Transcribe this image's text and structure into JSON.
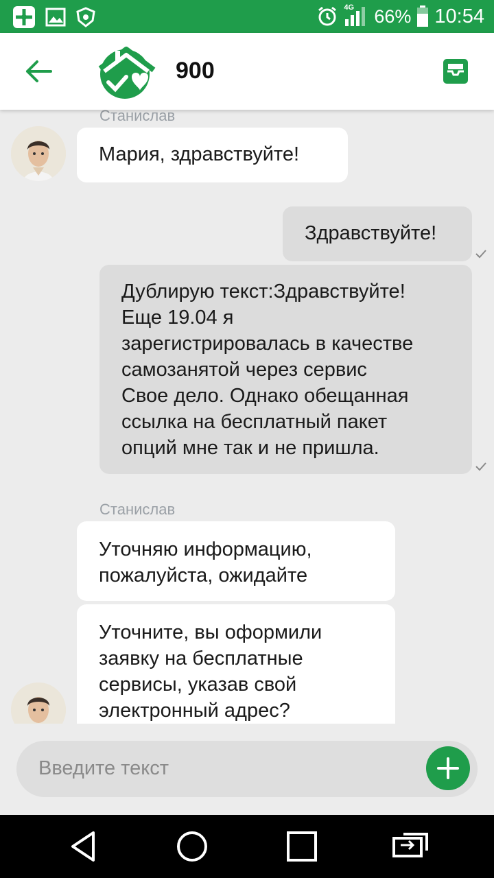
{
  "status_bar": {
    "network": "4G",
    "battery": "66%",
    "time": "10:54",
    "icons": [
      "app-icon",
      "gallery-icon",
      "antivirus-icon",
      "alarm-icon",
      "signal-icon",
      "battery-icon"
    ]
  },
  "header": {
    "title": "900",
    "back_icon": "arrow-left-icon",
    "inbox_icon": "inbox-icon",
    "brand_color": "#1f9d4b"
  },
  "messages": [
    {
      "sender": "Станислав",
      "text": "Мария, здравствуйте!",
      "direction": "in"
    },
    {
      "text": "Здравствуйте!",
      "direction": "out",
      "status": "sent"
    },
    {
      "lines": [
        "Дублирую текст:Здравствуйте!",
        "Еще 19.04 я",
        "зарегистрировалась в качестве",
        "самозанятой через сервис",
        "Свое дело. Однако обещанная",
        "ссылка на бесплатный пакет",
        "опций мне так и не пришла."
      ],
      "direction": "out",
      "status": "sent"
    },
    {
      "sender": "Станислав",
      "lines": [
        "Уточняю информацию,",
        "пожалуйста, ожидайте"
      ],
      "direction": "in"
    },
    {
      "lines": [
        "Уточните, вы оформили",
        "заявку на бесплатные",
        "сервисы, указав свой",
        "электронный адрес?"
      ],
      "direction": "in"
    }
  ],
  "composer": {
    "placeholder": "Введите текст",
    "add_icon": "plus-icon"
  },
  "nav_bar": {
    "icons": [
      "back-triangle-icon",
      "home-circle-icon",
      "recents-square-icon",
      "switch-app-icon"
    ]
  }
}
